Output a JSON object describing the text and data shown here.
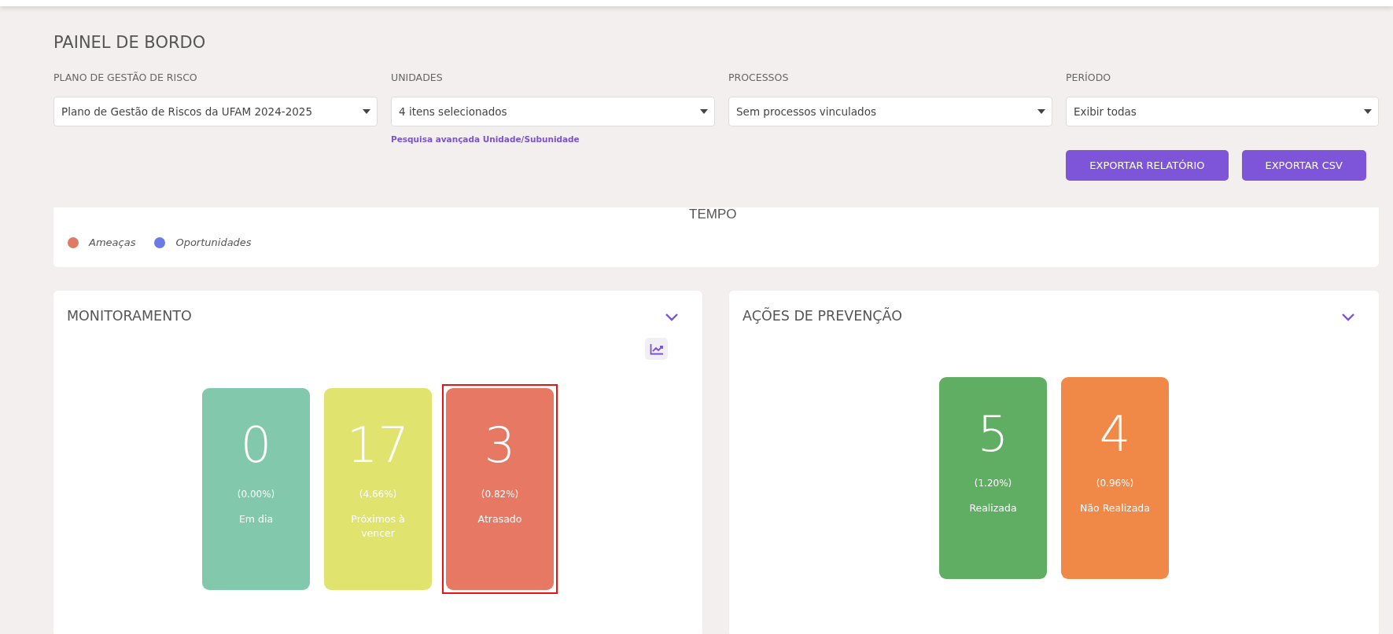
{
  "title": "PAINEL DE BORDO",
  "filters": [
    {
      "label": "PLANO DE GESTÃO DE RISCO",
      "value": "Plano de Gestão de Riscos da UFAM 2024-2025"
    },
    {
      "label": "UNIDADES",
      "value": "4 itens selecionados",
      "link": "Pesquisa avançada Unidade/Subunidade"
    },
    {
      "label": "PROCESSOS",
      "value": "Sem processos vinculados"
    },
    {
      "label": "PERÍODO",
      "value": "Exibir todas"
    }
  ],
  "buttons": [
    "EXPORTAR RELATÓRIO",
    "EXPORTAR CSV"
  ],
  "chart_panel": {
    "axis_title": "TEMPO",
    "legend": [
      {
        "label": "Ameaças",
        "color": "#e07a66"
      },
      {
        "label": "Oportunidades",
        "color": "#6a7be6"
      }
    ]
  },
  "panels": [
    {
      "title": "MONITORAMENTO",
      "chart_button": true,
      "tiles": [
        {
          "value": "0",
          "percent": "(0.00%)",
          "label": "Em dia",
          "color": "#82c8ad",
          "highlighted": false
        },
        {
          "value": "17",
          "percent": "(4.66%)",
          "label": "Próximos à vencer",
          "color": "#e0e36e",
          "highlighted": false
        },
        {
          "value": "3",
          "percent": "(0.82%)",
          "label": "Atrasado",
          "color": "#e77863",
          "highlighted": true
        }
      ]
    },
    {
      "title": "AÇÕES DE PREVENÇÃO",
      "chart_button": false,
      "tiles": [
        {
          "value": "5",
          "percent": "(1.20%)",
          "label": "Realizada",
          "color": "#5fae63",
          "highlighted": false
        },
        {
          "value": "4",
          "percent": "(0.96%)",
          "label": "Não Realizada",
          "color": "#f08848",
          "highlighted": false
        }
      ]
    }
  ]
}
